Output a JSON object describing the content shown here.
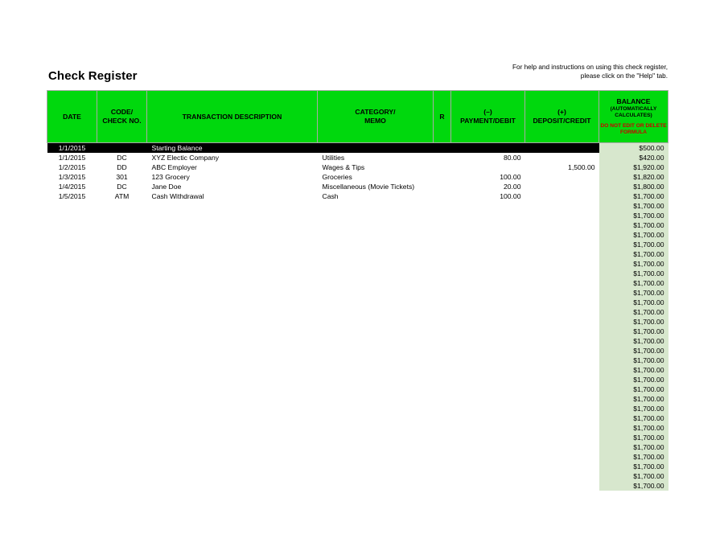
{
  "page": {
    "title": "Check Register",
    "help_note": "For help and instructions on using this check register, please click on the \"Help\" tab."
  },
  "colors": {
    "header_green": "#00d80d",
    "balance_green": "#d7e7cd",
    "debit_red": "#ff3333",
    "warning_red": "#cc0000",
    "start_row_black": "#000000"
  },
  "table": {
    "columns": [
      {
        "key": "date",
        "label": "DATE"
      },
      {
        "key": "code",
        "label_line1": "CODE/",
        "label_line2": "CHECK NO."
      },
      {
        "key": "desc",
        "label": "TRANSACTION DESCRIPTION"
      },
      {
        "key": "cat",
        "label_line1": "CATEGORY/",
        "label_line2": "MEMO"
      },
      {
        "key": "r",
        "label": "R"
      },
      {
        "key": "debit",
        "label_line1": "(–)",
        "label_line2": "PAYMENT/DEBIT"
      },
      {
        "key": "credit",
        "label_line1": "(+)",
        "label_line2": "DEPOSIT/CREDIT"
      },
      {
        "key": "balance",
        "label": "BALANCE",
        "label_sub": "(AUTOMATICALLY CALCULATES)",
        "label_warning": "DO NOT EDIT OR DELETE FORMULA"
      }
    ],
    "rows": [
      {
        "date": "1/1/2015",
        "code": "",
        "desc": "Starting Balance",
        "cat": "",
        "r": "",
        "debit": "",
        "credit": "",
        "balance": "$500.00",
        "style": "start"
      },
      {
        "date": "1/1/2015",
        "code": "DC",
        "desc": "XYZ Electic Company",
        "cat": "Utilities",
        "r": "",
        "debit": "80.00",
        "credit": "",
        "balance": "$420.00",
        "style": "normal"
      },
      {
        "date": "1/2/2015",
        "code": "DD",
        "desc": "ABC Employer",
        "cat": "Wages & Tips",
        "r": "",
        "debit": "",
        "credit": "1,500.00",
        "balance": "$1,920.00",
        "style": "normal"
      },
      {
        "date": "1/3/2015",
        "code": "301",
        "desc": "123 Grocery",
        "cat": "Groceries",
        "r": "",
        "debit": "100.00",
        "credit": "",
        "balance": "$1,820.00",
        "style": "normal"
      },
      {
        "date": "1/4/2015",
        "code": "DC",
        "desc": "Jane Doe",
        "cat": "Miscellaneous (Movie Tickets)",
        "r": "",
        "debit": "20.00",
        "credit": "",
        "balance": "$1,800.00",
        "style": "normal"
      },
      {
        "date": "1/5/2015",
        "code": "ATM",
        "desc": "Cash Withdrawal",
        "cat": "Cash",
        "r": "",
        "debit": "100.00",
        "credit": "",
        "balance": "$1,700.00",
        "style": "normal"
      },
      {
        "date": "",
        "code": "",
        "desc": "",
        "cat": "",
        "r": "",
        "debit": "",
        "credit": "",
        "balance": "$1,700.00",
        "style": "normal"
      },
      {
        "date": "",
        "code": "",
        "desc": "",
        "cat": "",
        "r": "",
        "debit": "",
        "credit": "",
        "balance": "$1,700.00",
        "style": "normal"
      },
      {
        "date": "",
        "code": "",
        "desc": "",
        "cat": "",
        "r": "",
        "debit": "",
        "credit": "",
        "balance": "$1,700.00",
        "style": "normal"
      },
      {
        "date": "",
        "code": "",
        "desc": "",
        "cat": "",
        "r": "",
        "debit": "",
        "credit": "",
        "balance": "$1,700.00",
        "style": "normal"
      },
      {
        "date": "",
        "code": "",
        "desc": "",
        "cat": "",
        "r": "",
        "debit": "",
        "credit": "",
        "balance": "$1,700.00",
        "style": "normal"
      },
      {
        "date": "",
        "code": "",
        "desc": "",
        "cat": "",
        "r": "",
        "debit": "",
        "credit": "",
        "balance": "$1,700.00",
        "style": "normal"
      },
      {
        "date": "",
        "code": "",
        "desc": "",
        "cat": "",
        "r": "",
        "debit": "",
        "credit": "",
        "balance": "$1,700.00",
        "style": "normal"
      },
      {
        "date": "",
        "code": "",
        "desc": "",
        "cat": "",
        "r": "",
        "debit": "",
        "credit": "",
        "balance": "$1,700.00",
        "style": "normal"
      },
      {
        "date": "",
        "code": "",
        "desc": "",
        "cat": "",
        "r": "",
        "debit": "",
        "credit": "",
        "balance": "$1,700.00",
        "style": "normal"
      },
      {
        "date": "",
        "code": "",
        "desc": "",
        "cat": "",
        "r": "",
        "debit": "",
        "credit": "",
        "balance": "$1,700.00",
        "style": "normal"
      },
      {
        "date": "",
        "code": "",
        "desc": "",
        "cat": "",
        "r": "",
        "debit": "",
        "credit": "",
        "balance": "$1,700.00",
        "style": "normal"
      },
      {
        "date": "",
        "code": "",
        "desc": "",
        "cat": "",
        "r": "",
        "debit": "",
        "credit": "",
        "balance": "$1,700.00",
        "style": "normal"
      },
      {
        "date": "",
        "code": "",
        "desc": "",
        "cat": "",
        "r": "",
        "debit": "",
        "credit": "",
        "balance": "$1,700.00",
        "style": "normal"
      },
      {
        "date": "",
        "code": "",
        "desc": "",
        "cat": "",
        "r": "",
        "debit": "",
        "credit": "",
        "balance": "$1,700.00",
        "style": "normal"
      },
      {
        "date": "",
        "code": "",
        "desc": "",
        "cat": "",
        "r": "",
        "debit": "",
        "credit": "",
        "balance": "$1,700.00",
        "style": "normal"
      },
      {
        "date": "",
        "code": "",
        "desc": "",
        "cat": "",
        "r": "",
        "debit": "",
        "credit": "",
        "balance": "$1,700.00",
        "style": "normal"
      },
      {
        "date": "",
        "code": "",
        "desc": "",
        "cat": "",
        "r": "",
        "debit": "",
        "credit": "",
        "balance": "$1,700.00",
        "style": "normal"
      },
      {
        "date": "",
        "code": "",
        "desc": "",
        "cat": "",
        "r": "",
        "debit": "",
        "credit": "",
        "balance": "$1,700.00",
        "style": "normal"
      },
      {
        "date": "",
        "code": "",
        "desc": "",
        "cat": "",
        "r": "",
        "debit": "",
        "credit": "",
        "balance": "$1,700.00",
        "style": "normal"
      },
      {
        "date": "",
        "code": "",
        "desc": "",
        "cat": "",
        "r": "",
        "debit": "",
        "credit": "",
        "balance": "$1,700.00",
        "style": "normal"
      },
      {
        "date": "",
        "code": "",
        "desc": "",
        "cat": "",
        "r": "",
        "debit": "",
        "credit": "",
        "balance": "$1,700.00",
        "style": "normal"
      },
      {
        "date": "",
        "code": "",
        "desc": "",
        "cat": "",
        "r": "",
        "debit": "",
        "credit": "",
        "balance": "$1,700.00",
        "style": "normal"
      },
      {
        "date": "",
        "code": "",
        "desc": "",
        "cat": "",
        "r": "",
        "debit": "",
        "credit": "",
        "balance": "$1,700.00",
        "style": "normal"
      },
      {
        "date": "",
        "code": "",
        "desc": "",
        "cat": "",
        "r": "",
        "debit": "",
        "credit": "",
        "balance": "$1,700.00",
        "style": "normal"
      },
      {
        "date": "",
        "code": "",
        "desc": "",
        "cat": "",
        "r": "",
        "debit": "",
        "credit": "",
        "balance": "$1,700.00",
        "style": "normal"
      },
      {
        "date": "",
        "code": "",
        "desc": "",
        "cat": "",
        "r": "",
        "debit": "",
        "credit": "",
        "balance": "$1,700.00",
        "style": "normal"
      },
      {
        "date": "",
        "code": "",
        "desc": "",
        "cat": "",
        "r": "",
        "debit": "",
        "credit": "",
        "balance": "$1,700.00",
        "style": "normal"
      },
      {
        "date": "",
        "code": "",
        "desc": "",
        "cat": "",
        "r": "",
        "debit": "",
        "credit": "",
        "balance": "$1,700.00",
        "style": "normal"
      },
      {
        "date": "",
        "code": "",
        "desc": "",
        "cat": "",
        "r": "",
        "debit": "",
        "credit": "",
        "balance": "$1,700.00",
        "style": "normal"
      },
      {
        "date": "",
        "code": "",
        "desc": "",
        "cat": "",
        "r": "",
        "debit": "",
        "credit": "",
        "balance": "$1,700.00",
        "style": "normal"
      }
    ]
  }
}
